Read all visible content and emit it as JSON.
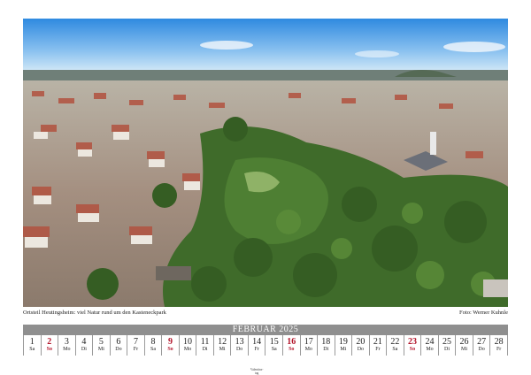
{
  "photo_caption": "Ortsteil Heutingsheim: viel Natur rund um den Kasteneckpark",
  "photo_credit": "Foto: Werner Kuhnle",
  "month_title": "FEBRUAR 2025",
  "days": [
    {
      "n": "1",
      "wd": "Sa"
    },
    {
      "n": "2",
      "wd": "So",
      "sun": true
    },
    {
      "n": "3",
      "wd": "Mo"
    },
    {
      "n": "4",
      "wd": "Di"
    },
    {
      "n": "5",
      "wd": "Mi"
    },
    {
      "n": "6",
      "wd": "Do"
    },
    {
      "n": "7",
      "wd": "Fr"
    },
    {
      "n": "8",
      "wd": "Sa"
    },
    {
      "n": "9",
      "wd": "So",
      "sun": true
    },
    {
      "n": "10",
      "wd": "Mo"
    },
    {
      "n": "11",
      "wd": "Di"
    },
    {
      "n": "12",
      "wd": "Mi"
    },
    {
      "n": "13",
      "wd": "Do"
    },
    {
      "n": "14",
      "wd": "Fr",
      "note": "Valentins-tag"
    },
    {
      "n": "15",
      "wd": "Sa"
    },
    {
      "n": "16",
      "wd": "So",
      "sun": true
    },
    {
      "n": "17",
      "wd": "Mo"
    },
    {
      "n": "18",
      "wd": "Di"
    },
    {
      "n": "19",
      "wd": "Mi"
    },
    {
      "n": "20",
      "wd": "Do"
    },
    {
      "n": "21",
      "wd": "Fr"
    },
    {
      "n": "22",
      "wd": "Sa"
    },
    {
      "n": "23",
      "wd": "So",
      "sun": true
    },
    {
      "n": "24",
      "wd": "Mo"
    },
    {
      "n": "25",
      "wd": "Di"
    },
    {
      "n": "26",
      "wd": "Mi"
    },
    {
      "n": "27",
      "wd": "Do"
    },
    {
      "n": "28",
      "wd": "Fr"
    }
  ]
}
